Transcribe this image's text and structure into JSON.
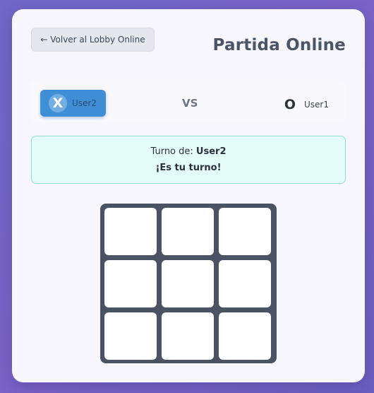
{
  "header": {
    "back_label": "← Volver al Lobby Online",
    "title": "Partida Online"
  },
  "players": {
    "x": {
      "symbol": "X",
      "name": "User2",
      "color": "#3f8fd6"
    },
    "vs": "VS",
    "o": {
      "symbol": "O",
      "name": "User1"
    }
  },
  "status": {
    "turn_prefix": "Turno de: ",
    "turn_player": "User2",
    "message": "¡Es tu turno!"
  },
  "board": {
    "cells": [
      "",
      "",
      "",
      "",
      "",
      "",
      "",
      "",
      ""
    ]
  }
}
